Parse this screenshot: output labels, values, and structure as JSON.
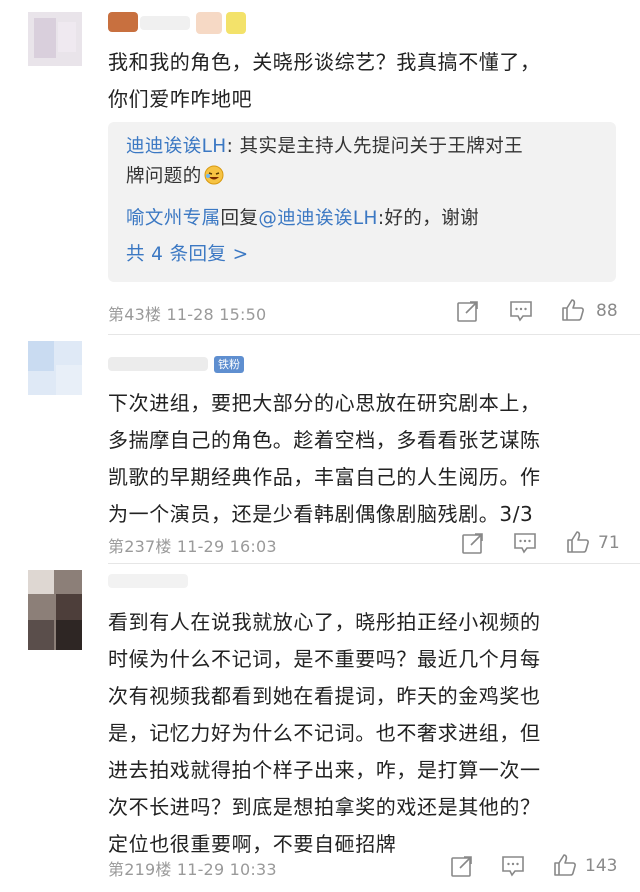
{
  "comments": [
    {
      "text_lines": [
        "我和我的角色，关晓彤谈综艺？我真搞不懂了，",
        "你们爱咋咋地吧"
      ],
      "replies": [
        {
          "user": "迪迪诶诶LH",
          "sep": ": ",
          "content": "其实是主持人先提问关于王牌对王",
          "content2": "牌问题的"
        },
        {
          "user": "喻文州专属",
          "mid": "回复",
          "at": "@迪迪诶诶LH",
          "content": ":好的，谢谢"
        }
      ],
      "more_replies": "共 4 条回复 >",
      "meta": "第43楼  11-28 15:50",
      "likes": "88"
    },
    {
      "badge": "铁粉",
      "text_lines": [
        "下次进组，要把大部分的心思放在研究剧本上，",
        "多揣摩自己的角色。趁着空档，多看看张艺谋陈",
        "凯歌的早期经典作品，丰富自己的人生阅历。作",
        "为一个演员，还是少看韩剧偶像剧脑残剧。3/3"
      ],
      "meta": "第237楼  11-29 16:03",
      "likes": "71"
    },
    {
      "text_lines": [
        "看到有人在说我就放心了，晓彤拍正经小视频的",
        "时候为什么不记词，是不重要吗？最近几个月每",
        "次有视频我都看到她在看提词，昨天的金鸡奖也",
        "是，记忆力好为什么不记词。也不奢求进组，但",
        "进去拍戏就得拍个样子出来，咋，是打算一次一",
        "次不长进吗？到底是想拍拿奖的戏还是其他的？",
        "定位也很重要啊，不要自砸招牌"
      ],
      "meta": "第219楼  11-29 10:33",
      "likes": "143"
    }
  ],
  "icons": {
    "share": "share-icon",
    "comment": "comment-icon",
    "like": "thumbs-up-icon",
    "emoji": "laughing-emoji-icon"
  },
  "colors": {
    "link": "#3b78c3",
    "meta": "#9a9a9a",
    "reply_bg": "#f2f2f2",
    "badge": "#5f8fd0"
  }
}
